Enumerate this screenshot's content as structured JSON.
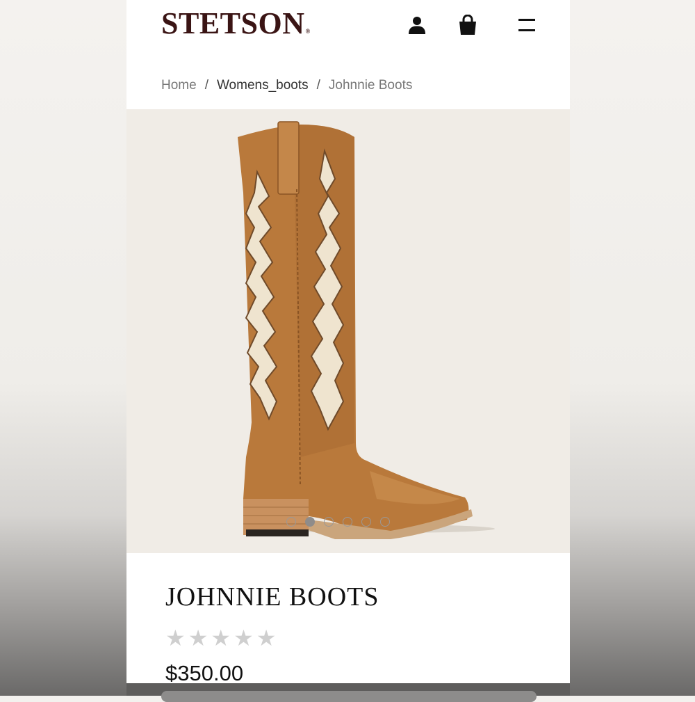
{
  "brand": {
    "logo_text": "STETSON",
    "logo_mark": "®",
    "color": "#3a1414"
  },
  "header": {
    "icons": [
      "account-icon",
      "shopping-bag-icon",
      "menu-icon"
    ]
  },
  "breadcrumb": {
    "items": [
      "Home",
      "Womens_boots",
      "Johnnie Boots"
    ],
    "separator": "/"
  },
  "product": {
    "title": "JOHNNIE BOOTS",
    "rating": {
      "value": 0,
      "max": 5,
      "star_glyph": "★"
    },
    "price": "$350.00",
    "image_alt": "Tall tan leather western boot with cream zigzag inlay"
  },
  "carousel": {
    "count": 6,
    "active_index": 1
  },
  "colors": {
    "hero_bg": "#f0ece6",
    "boot": "#b9793b",
    "inlay": "#efe4cf"
  }
}
